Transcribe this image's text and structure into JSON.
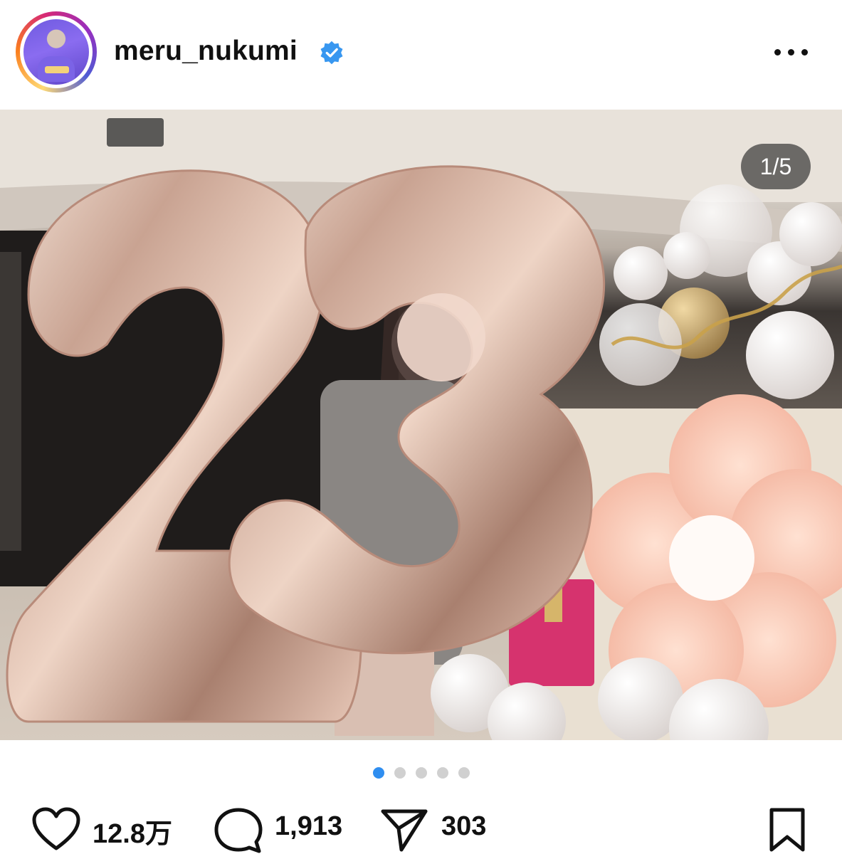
{
  "post": {
    "username": "meru_nukumi",
    "image_counter": "1/5",
    "carousel": {
      "total": 5,
      "active_index": 0
    },
    "likes": "12.8万",
    "comments": "1,913",
    "shares": "303"
  },
  "icons": {
    "verified": "verified-badge-icon",
    "more": "more-options-icon",
    "like": "heart-icon",
    "comment": "comment-bubble-icon",
    "share": "paper-plane-icon",
    "save": "bookmark-icon"
  },
  "colors": {
    "verified_blue": "#3897f0",
    "active_dot": "#2f8ef0",
    "inactive_dot": "#d0d0d0"
  }
}
